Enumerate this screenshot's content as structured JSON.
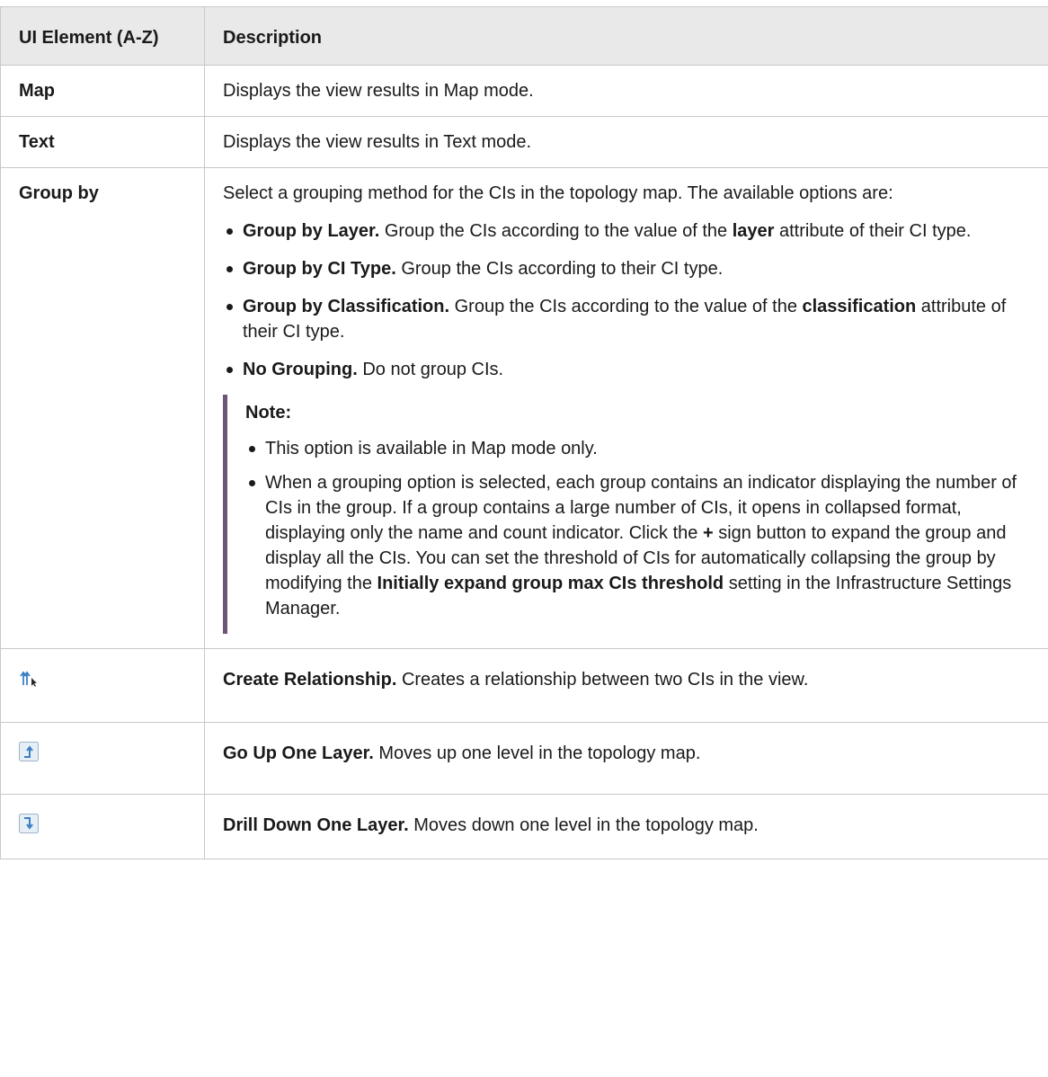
{
  "header": {
    "col1": "UI Element (A-Z)",
    "col2": "Description"
  },
  "rows": {
    "map": {
      "name": "Map",
      "desc": "Displays the view results in Map mode."
    },
    "text": {
      "name": "Text",
      "desc": "Displays the view results in Text mode."
    },
    "group_by": {
      "name": "Group by",
      "intro": "Select a grouping method for the CIs in the topology map. The available options are:",
      "options": [
        {
          "title": "Group by Layer.",
          "text_a": " Group the CIs according to the value of the ",
          "bold": "layer",
          "text_b": " attribute of their CI type."
        },
        {
          "title": "Group by CI Type.",
          "text": " Group the CIs according to their CI type."
        },
        {
          "title": "Group by Classification.",
          "text_a": " Group the CIs according to the value of the ",
          "bold": "classification",
          "text_b": " attribute of their CI type."
        },
        {
          "title": "No Grouping.",
          "text": " Do not group CIs."
        }
      ],
      "note": {
        "title": "Note:",
        "item1": "This option is available in Map mode only.",
        "item2_a": "When a grouping option is selected, each group contains an indicator displaying the number of CIs in the group. If a group contains a large number of CIs, it opens in collapsed format, displaying only the name and count indicator. Click the ",
        "item2_plus": "+",
        "item2_b": " sign button to expand the group and display all the CIs. You can set the threshold of CIs for automatically collapsing the group by modifying the ",
        "item2_setting": "Initially expand group max CIs threshold",
        "item2_c": " setting in the Infrastructure Settings Manager."
      }
    },
    "create_rel": {
      "icon": "create-relationship-icon",
      "title": "Create Relationship.",
      "desc": " Creates a relationship between two CIs in the view."
    },
    "go_up": {
      "icon": "go-up-one-layer-icon",
      "title": "Go Up One Layer.",
      "desc": " Moves up one level in the topology map."
    },
    "drill_down": {
      "icon": "drill-down-one-layer-icon",
      "title": "Drill Down One Layer.",
      "desc": " Moves down one level in the topology map."
    }
  },
  "colors": {
    "header_bg": "#e9e9e9",
    "border": "#c8c8c8",
    "note_bar": "#6e5476",
    "icon_blue": "#3a7fc4"
  }
}
